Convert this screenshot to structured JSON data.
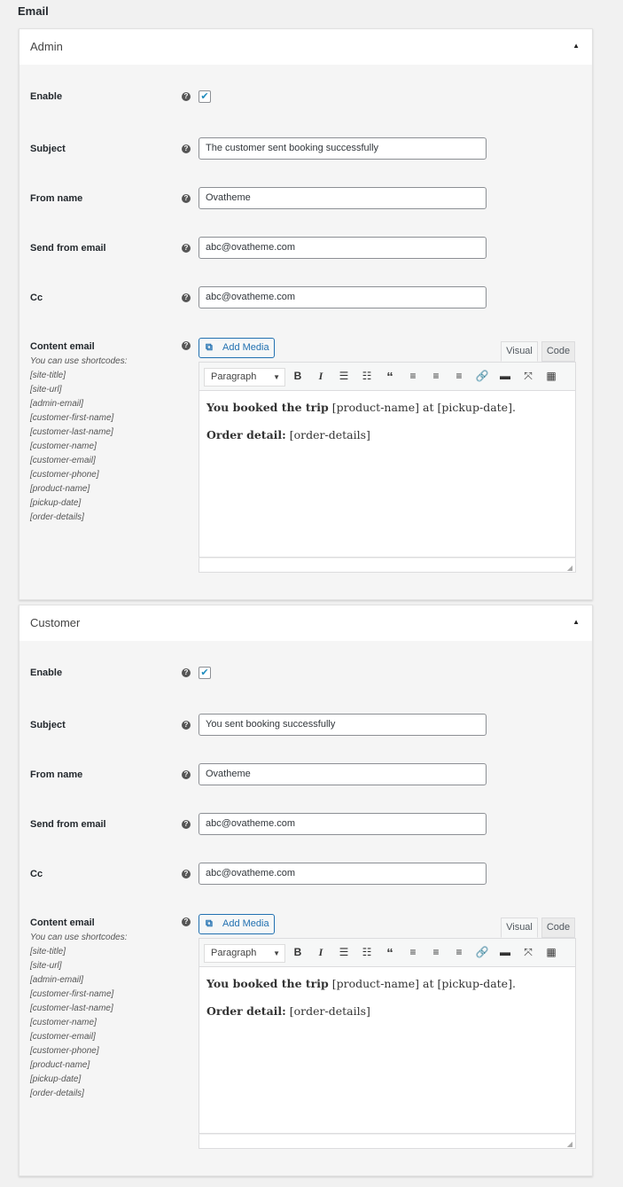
{
  "section_title": "Email",
  "labels": {
    "enable": "Enable",
    "subject": "Subject",
    "from_name": "From name",
    "send_from": "Send from email",
    "cc": "Cc",
    "content": "Content email",
    "hint": "You can use shortcodes:"
  },
  "shortcodes": [
    "[site-title]",
    "[site-url]",
    "[admin-email]",
    "[customer-first-name]",
    "[customer-last-name]",
    "[customer-name]",
    "[customer-email]",
    "[customer-phone]",
    "[product-name]",
    "[pickup-date]",
    "[order-details]"
  ],
  "editor": {
    "add_media": "Add Media",
    "tab_visual": "Visual",
    "tab_code": "Code",
    "format": "Paragraph"
  },
  "admin": {
    "title": "Admin",
    "enabled": true,
    "subject": "The customer sent booking successfully",
    "from_name": "Ovatheme",
    "send_from": "abc@ovatheme.com",
    "cc": "abc@ovatheme.com",
    "line1_bold": "You booked the trip",
    "line1_rest": " [product-name] at [pickup-date].",
    "line2_bold": "Order detail:",
    "line2_rest": " [order-details]"
  },
  "customer": {
    "title": "Customer",
    "enabled": true,
    "subject": "You sent booking successfully",
    "from_name": "Ovatheme",
    "send_from": "abc@ovatheme.com",
    "cc": "abc@ovatheme.com",
    "line1_bold": "You booked the trip",
    "line1_rest": " [product-name] at [pickup-date].",
    "line2_bold": "Order detail:",
    "line2_rest": " [order-details]"
  }
}
